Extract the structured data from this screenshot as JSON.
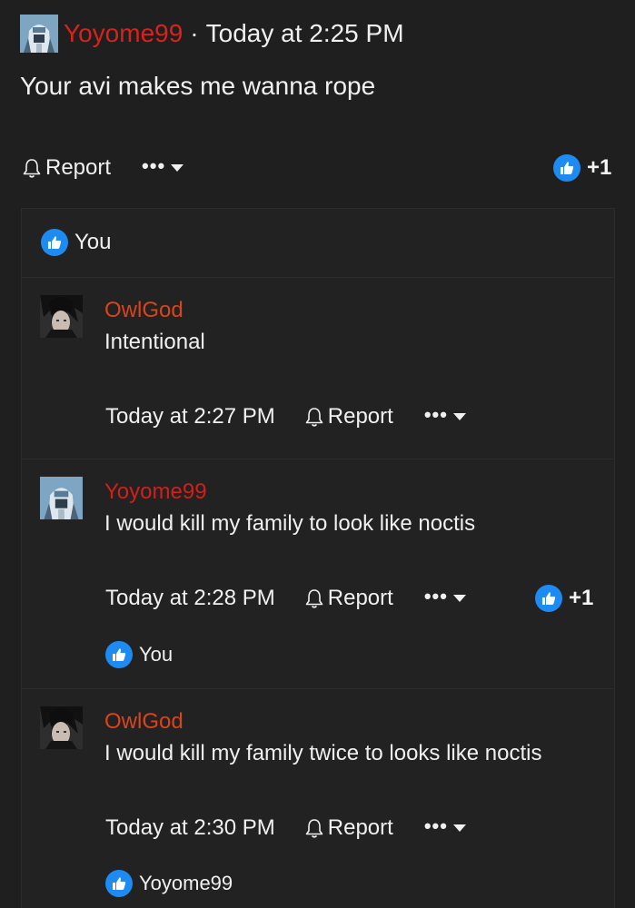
{
  "post": {
    "username": "Yoyome99",
    "separator": "·",
    "time": "Today at 2:25 PM",
    "body": "Your avi makes me wanna rope",
    "report_label": "Report",
    "more_label": "•••",
    "like_count": "+1"
  },
  "replies_box": {
    "likes_text": "You"
  },
  "replies": [
    {
      "username": "OwlGod",
      "text": "Intentional",
      "time": "Today at 2:27 PM",
      "report_label": "Report",
      "more_label": "•••"
    },
    {
      "username": "Yoyome99",
      "text": "I would kill my family to look like noctis",
      "time": "Today at 2:28 PM",
      "report_label": "Report",
      "more_label": "•••",
      "like_count": "+1",
      "likes_text": "You"
    },
    {
      "username": "OwlGod",
      "text": "I would kill my family twice to looks like noctis",
      "time": "Today at 2:30 PM",
      "report_label": "Report",
      "more_label": "•••",
      "likes_text": "Yoyome99"
    }
  ],
  "colors": {
    "background": "#1f1f1f",
    "panel": "#222222",
    "username_red": "#d9221c",
    "username_orange": "#d9441c",
    "like_blue": "#1d8bf1"
  },
  "icons": [
    "bell-icon",
    "caret-down-icon",
    "thumbs-up-icon",
    "avatar-robot",
    "avatar-dark-hair"
  ]
}
